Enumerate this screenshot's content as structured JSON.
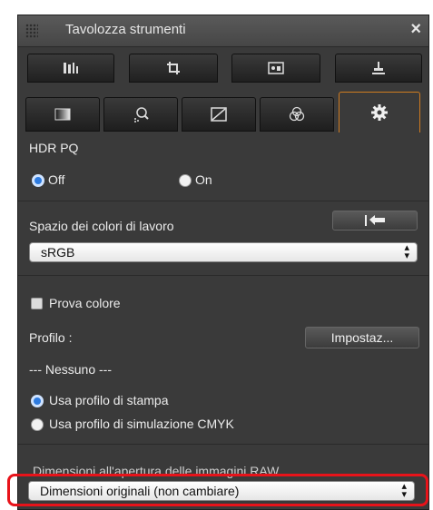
{
  "window": {
    "title": "Tavolozza strumenti",
    "close_label": "×"
  },
  "tabs_row1": [
    {
      "icon": "histogram-adjust-icon",
      "label": "▮▮▯▮"
    },
    {
      "icon": "crop-icon",
      "label": "⌗"
    },
    {
      "icon": "image-icon",
      "label": "▣"
    },
    {
      "icon": "stamp-icon",
      "label": "⊥"
    }
  ],
  "tabs_row2": [
    {
      "icon": "gradient-icon",
      "active": false
    },
    {
      "icon": "dust-delete-icon",
      "active": false
    },
    {
      "icon": "tone-curve-icon",
      "active": false
    },
    {
      "icon": "color-balance-icon",
      "active": false
    },
    {
      "icon": "settings-gear-icon",
      "active": true
    }
  ],
  "hdr": {
    "heading": "HDR PQ",
    "off_label": "Off",
    "on_label": "On",
    "selected": "Off"
  },
  "workspace": {
    "label": "Spazio dei colori di lavoro",
    "reset_icon": "reset-arrow-icon",
    "value": "sRGB"
  },
  "proof": {
    "checkbox_label": "Prova colore",
    "profile_label": "Profilo :",
    "settings_button": "Impostaz...",
    "profile_value": "---   Nessuno   ---"
  },
  "print_options": {
    "option1": "Usa profilo di stampa",
    "option2": "Usa profilo di simulazione CMYK",
    "selected": "option1"
  },
  "raw_size": {
    "label": "Dimensioni all'apertura delle immagini RAW",
    "value": "Dimensioni originali (non cambiare)"
  },
  "colors": {
    "accent": "#d07c20",
    "highlight": "#e8131a",
    "radio_selected": "#2d7be0"
  }
}
